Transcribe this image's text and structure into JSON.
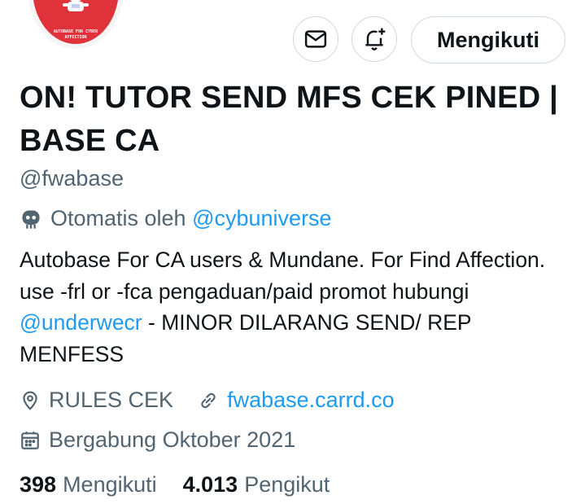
{
  "profile": {
    "avatar_text_line1": "AUTOBASE FOR CYBER",
    "avatar_text_line2": "AFFECTION",
    "display_name": "ON! TUTOR SEND MFS CEK PINED | BASE CA",
    "handle": "@fwabase",
    "automated_prefix": "Otomatis oleh",
    "automated_by": "@cybuniverse",
    "bio_part1": "Autobase For CA users & Mundane. For Find Affection.  use -frl or -fca pengaduan/paid promot hubungi",
    "bio_mention": "@underwecr",
    "bio_part2": " - MINOR DILARANG SEND/ REP MENFESS",
    "location": "RULES CEK",
    "website": "fwabase.carrd.co",
    "joined": "Bergabung Oktober 2021"
  },
  "actions": {
    "message_icon": "mail-icon",
    "notify_icon": "bell-plus-icon",
    "follow_label": "Mengikuti"
  },
  "stats": {
    "following_count": "398",
    "following_label": "Mengikuti",
    "followers_count": "4.013",
    "followers_label": "Pengikut"
  },
  "colors": {
    "accent": "#1d9bf0",
    "text": "#0f1419",
    "secondary": "#536471",
    "avatar_bg": "#e0323a"
  }
}
